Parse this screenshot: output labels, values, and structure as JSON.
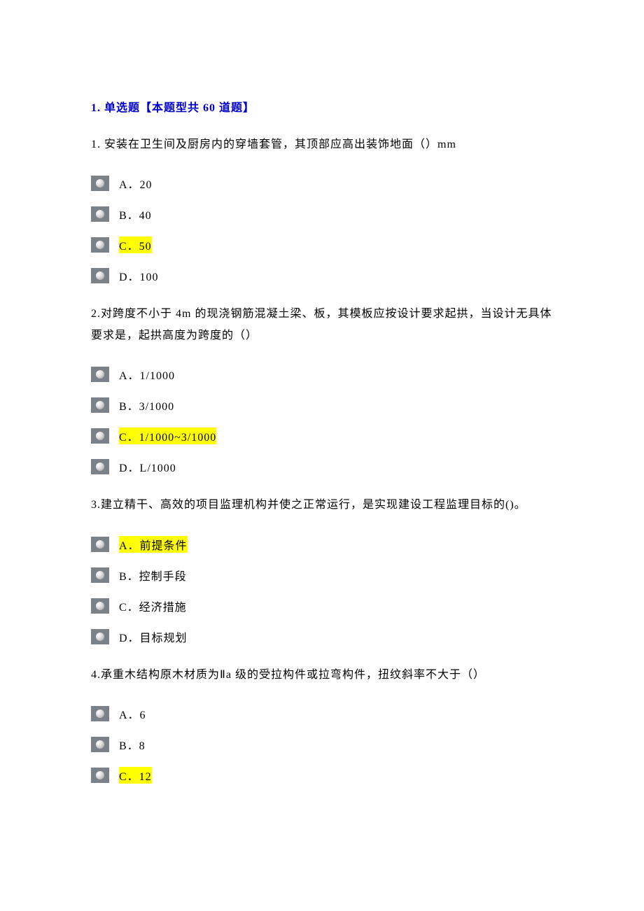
{
  "section_title": "1. 单选题【本题型共 60 道题】",
  "questions": [
    {
      "text": "1. 安装在卫生间及厨房内的穿墙套管，其顶部应高出装饰地面（）mm",
      "options": [
        {
          "label": "A．20",
          "highlighted": false
        },
        {
          "label": "B．40",
          "highlighted": false
        },
        {
          "label": "C．50",
          "highlighted": true
        },
        {
          "label": "D．100",
          "highlighted": false
        }
      ]
    },
    {
      "text": "2.对跨度不小于 4m 的现浇钢筋混凝土梁、板，其模板应按设计要求起拱，当设计无具体要求是，起拱高度为跨度的（）",
      "options": [
        {
          "label": "A．1/1000",
          "highlighted": false
        },
        {
          "label": "B．3/1000",
          "highlighted": false
        },
        {
          "label": "C．1/1000~3/1000",
          "highlighted": true
        },
        {
          "label": "D．L/1000",
          "highlighted": false
        }
      ]
    },
    {
      "text": "3.建立精干、高效的项目监理机构并使之正常运行，是实现建设工程监理目标的()。",
      "options": [
        {
          "label": "A．前提条件",
          "highlighted": true
        },
        {
          "label": "B．控制手段",
          "highlighted": false
        },
        {
          "label": "C．经济措施",
          "highlighted": false
        },
        {
          "label": "D．目标规划",
          "highlighted": false
        }
      ]
    },
    {
      "text": "4.承重木结构原木材质为Ⅱa 级的受拉构件或拉弯构件，扭纹斜率不大于（）",
      "options": [
        {
          "label": "A．6",
          "highlighted": false
        },
        {
          "label": "B．8",
          "highlighted": false
        },
        {
          "label": "C．12",
          "highlighted": true
        }
      ]
    }
  ]
}
